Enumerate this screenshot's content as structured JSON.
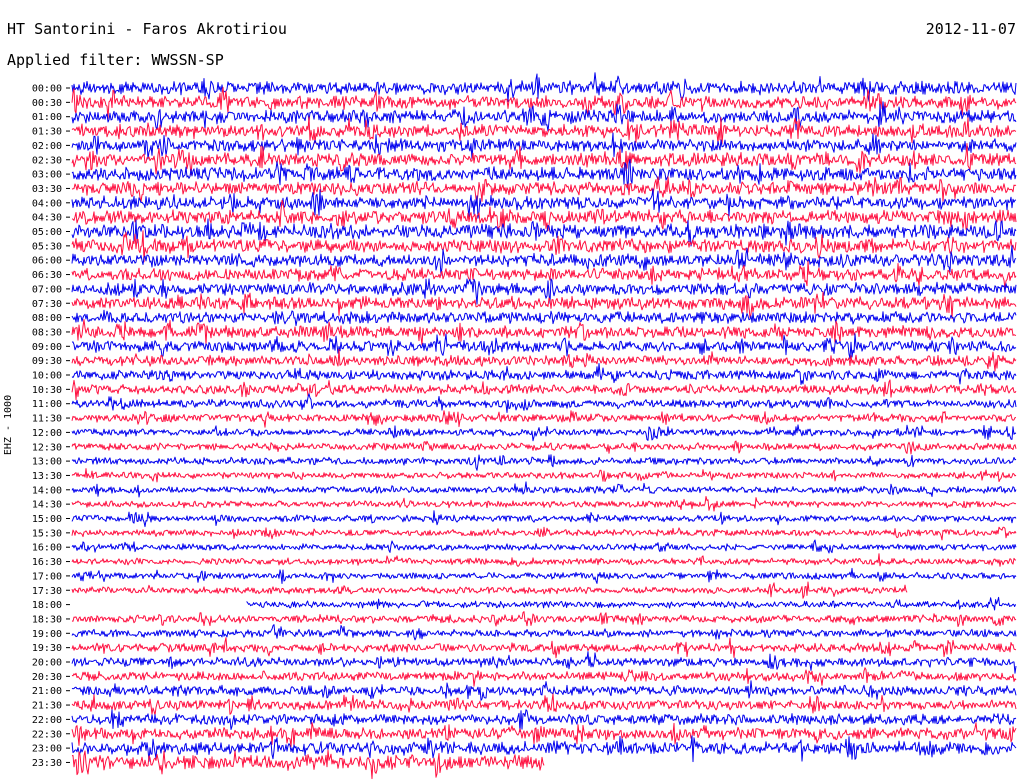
{
  "header": {
    "station": "HT Santorini - Faros Akrotiriou",
    "date": "2012-11-07",
    "filter": "Applied filter: WWSSN-SP"
  },
  "chart_data": {
    "type": "line",
    "title": "HT Santorini - Faros Akrotiriou",
    "date": "2012-11-07",
    "filter": "WWSSN-SP",
    "ylabel": "EHZ - 1000",
    "xlabel": "",
    "rows": [
      "00:00",
      "00:30",
      "01:00",
      "01:30",
      "02:00",
      "02:30",
      "03:00",
      "03:30",
      "04:00",
      "04:30",
      "05:00",
      "05:30",
      "06:00",
      "06:30",
      "07:00",
      "07:30",
      "08:00",
      "08:30",
      "09:00",
      "09:30",
      "10:00",
      "10:30",
      "11:00",
      "11:30",
      "12:00",
      "12:30",
      "13:00",
      "13:30",
      "14:00",
      "14:30",
      "15:00",
      "15:30",
      "16:00",
      "16:30",
      "17:00",
      "17:30",
      "18:00",
      "18:30",
      "19:00",
      "19:30",
      "20:00",
      "20:30",
      "21:00",
      "21:30",
      "22:00",
      "22:30",
      "23:00",
      "23:30"
    ],
    "colors": [
      "#0000ee",
      "#ff1040"
    ],
    "color_pattern": "alternating, starting blue at 00:00",
    "relative_amplitude": [
      1.0,
      1.0,
      1.0,
      0.95,
      0.95,
      1.0,
      1.05,
      1.0,
      1.0,
      1.05,
      1.1,
      1.0,
      0.95,
      0.95,
      0.95,
      0.95,
      0.9,
      0.9,
      0.85,
      0.8,
      0.75,
      0.7,
      0.65,
      0.6,
      0.55,
      0.55,
      0.55,
      0.5,
      0.5,
      0.5,
      0.5,
      0.5,
      0.5,
      0.5,
      0.5,
      0.5,
      0.5,
      0.6,
      0.6,
      0.65,
      0.7,
      0.7,
      0.75,
      0.75,
      0.8,
      0.9,
      1.0,
      1.1
    ],
    "coverage": [
      {
        "row": "17:30",
        "start": 0.0,
        "end": 0.885
      },
      {
        "row": "18:00",
        "start": 0.185,
        "end": 1.0
      },
      {
        "row": "23:30",
        "start": 0.0,
        "end": 0.5
      }
    ],
    "grid": false,
    "legend": "none"
  }
}
